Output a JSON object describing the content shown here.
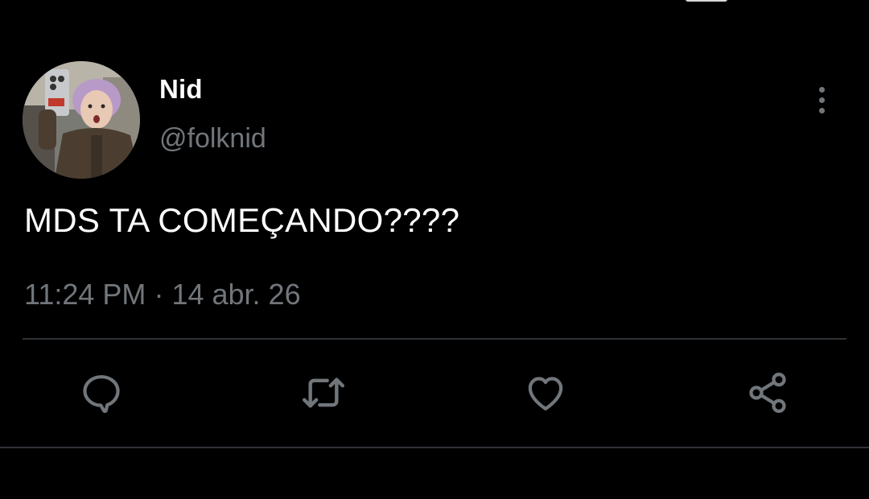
{
  "tweet": {
    "author": {
      "display_name": "Nid",
      "handle": "@folknid",
      "avatar_icon": "user-avatar-photo"
    },
    "text": "MDS TA COMEÇANDO????",
    "time": "11:24 PM",
    "separator": "·",
    "date": "14 abr. 26"
  },
  "actions": [
    {
      "name": "reply",
      "icon": "reply-icon"
    },
    {
      "name": "retweet",
      "icon": "retweet-icon"
    },
    {
      "name": "like",
      "icon": "heart-icon"
    },
    {
      "name": "share",
      "icon": "share-icon"
    }
  ],
  "colors": {
    "background": "#000000",
    "primary_text": "#ffffff",
    "secondary_text": "#71767b",
    "divider": "#2f3336"
  }
}
